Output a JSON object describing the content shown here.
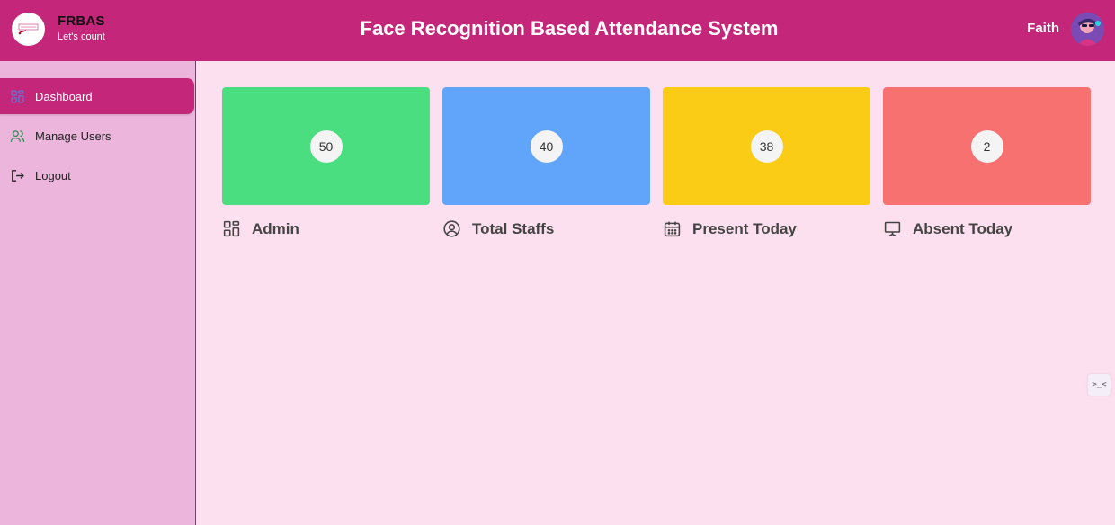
{
  "header": {
    "brand_name": "FRBAS",
    "brand_tagline": "Let's count",
    "title": "Face Recognition Based Attendance System",
    "user_name": "Faith",
    "colors": {
      "bar": "#c4267a",
      "page": "#fde0ef",
      "sidebar": "#ecb5dc"
    }
  },
  "sidebar": {
    "items": [
      {
        "label": "Dashboard",
        "icon": "dashboard-grid-icon",
        "active": true
      },
      {
        "label": "Manage Users",
        "icon": "users-icon",
        "active": false
      },
      {
        "label": "Logout",
        "icon": "logout-icon",
        "active": false
      }
    ]
  },
  "cards": [
    {
      "count": "50",
      "label": "Admin",
      "icon": "dashboard-grid-icon",
      "color": "#4ade80"
    },
    {
      "count": "40",
      "label": "Total Staffs",
      "icon": "user-circle-icon",
      "color": "#60a5fa"
    },
    {
      "count": "38",
      "label": "Present Today",
      "icon": "calendar-icon",
      "color": "#facc15"
    },
    {
      "count": "2",
      "label": "Absent Today",
      "icon": "presentation-board-icon",
      "color": "#f87171"
    }
  ],
  "fab": {
    "icon": "code-chat-icon",
    "glyph": ">_<"
  }
}
